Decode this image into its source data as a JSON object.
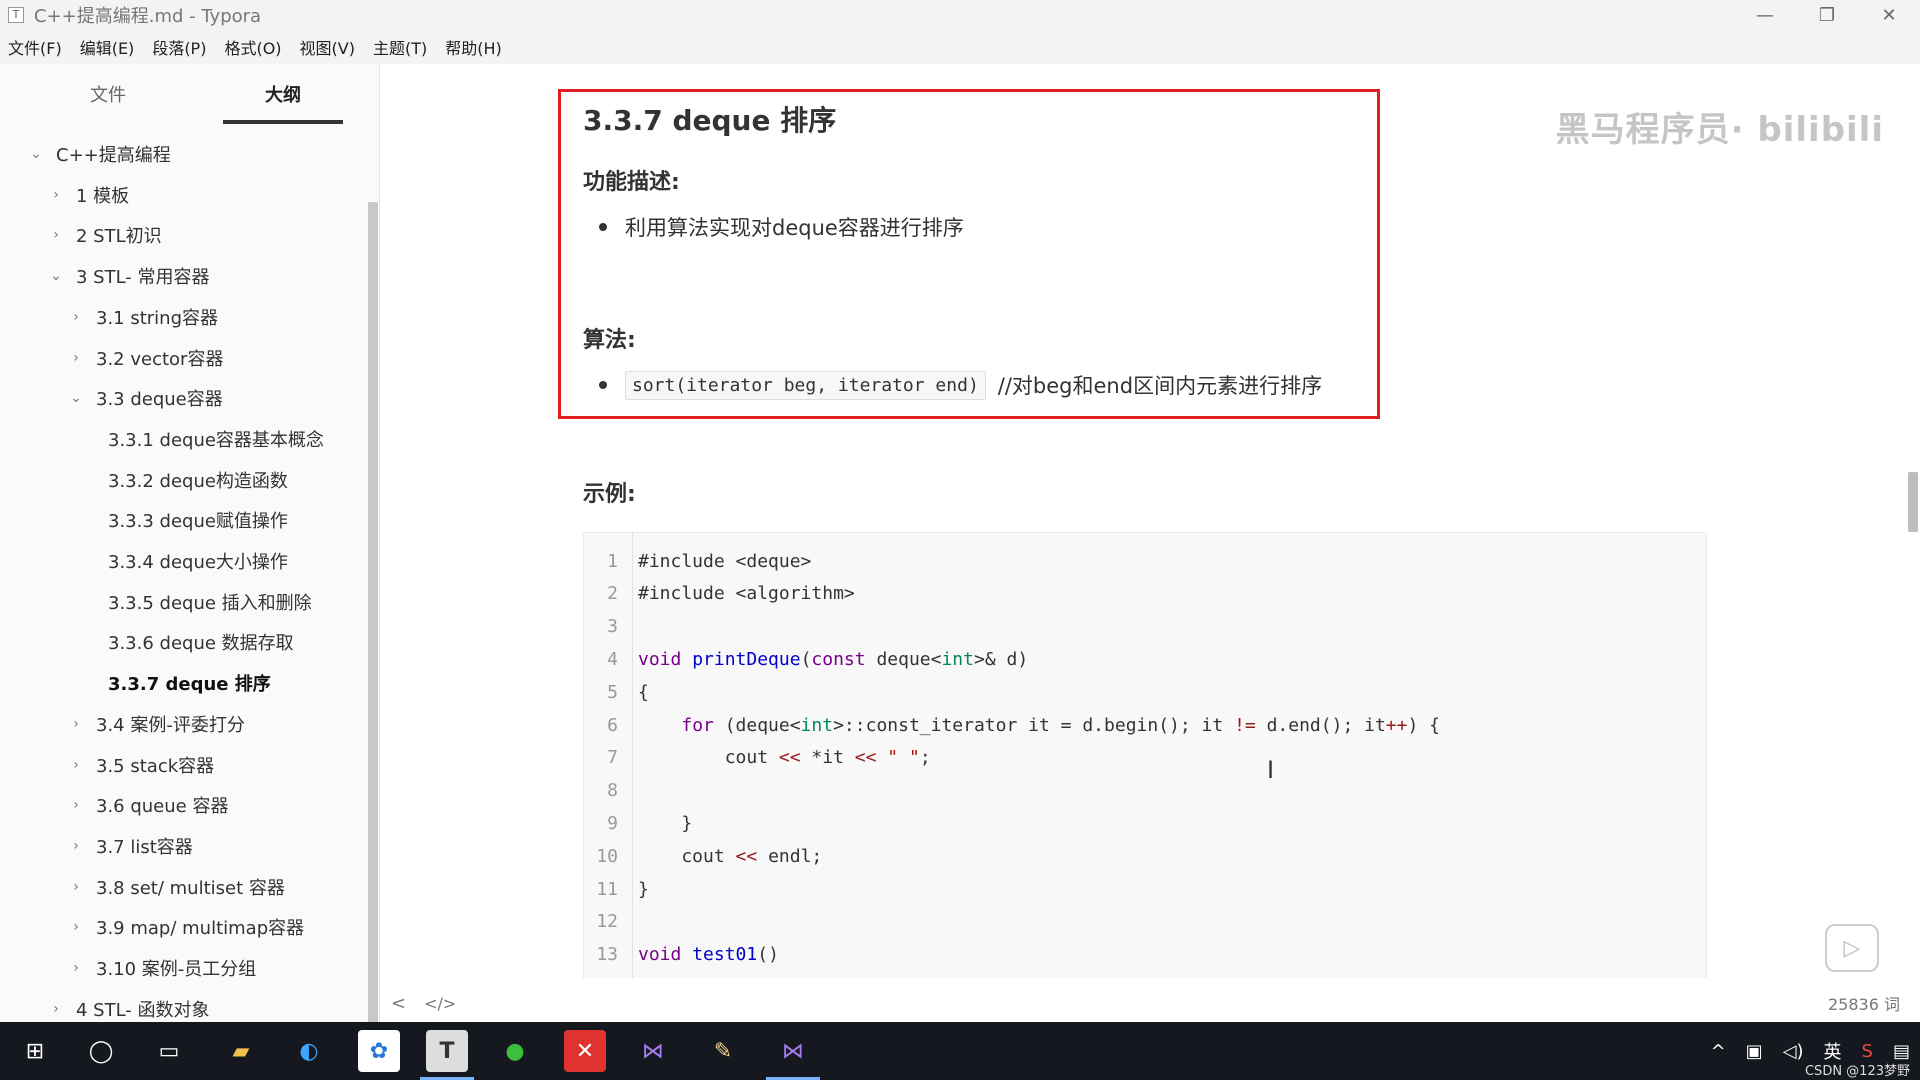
{
  "window": {
    "app_icon": "T",
    "title": "C++提高编程.md - Typora",
    "minimize": "—",
    "restore": "❐",
    "close": "✕"
  },
  "menu": [
    "文件(F)",
    "编辑(E)",
    "段落(P)",
    "格式(O)",
    "视图(V)",
    "主题(T)",
    "帮助(H)"
  ],
  "sidebar": {
    "tabs": [
      "文件",
      "大纲"
    ],
    "outline": [
      {
        "label": "C++提高编程",
        "level": 0,
        "expanded": true
      },
      {
        "label": "1 模板",
        "level": 1,
        "expanded": false
      },
      {
        "label": "2 STL初识",
        "level": 1,
        "expanded": false
      },
      {
        "label": "3 STL- 常用容器",
        "level": 1,
        "expanded": true
      },
      {
        "label": "3.1 string容器",
        "level": 2,
        "expanded": false
      },
      {
        "label": "3.2 vector容器",
        "level": 2,
        "expanded": false
      },
      {
        "label": "3.3 deque容器",
        "level": 2,
        "expanded": true
      },
      {
        "label": "3.3.1 deque容器基本概念",
        "level": 3
      },
      {
        "label": "3.3.2 deque构造函数",
        "level": 3
      },
      {
        "label": "3.3.3 deque赋值操作",
        "level": 3
      },
      {
        "label": "3.3.4 deque大小操作",
        "level": 3
      },
      {
        "label": "3.3.5 deque 插入和删除",
        "level": 3
      },
      {
        "label": "3.3.6 deque 数据存取",
        "level": 3
      },
      {
        "label": "3.3.7 deque 排序",
        "level": 3,
        "active": true
      },
      {
        "label": "3.4 案例-评委打分",
        "level": 2,
        "expanded": false
      },
      {
        "label": "3.5 stack容器",
        "level": 2,
        "expanded": false
      },
      {
        "label": "3.6 queue 容器",
        "level": 2,
        "expanded": false
      },
      {
        "label": "3.7 list容器",
        "level": 2,
        "expanded": false
      },
      {
        "label": "3.8 set/ multiset 容器",
        "level": 2,
        "expanded": false
      },
      {
        "label": "3.9 map/ multimap容器",
        "level": 2,
        "expanded": false
      },
      {
        "label": "3.10 案例-员工分组",
        "level": 2,
        "expanded": false
      },
      {
        "label": "4 STL- 函数对象",
        "level": 1,
        "expanded": false
      }
    ]
  },
  "doc": {
    "heading": "3.3.7  deque 排序",
    "section_func": "功能描述:",
    "func_bullet": "利用算法实现对deque容器进行排序",
    "section_algo": "算法:",
    "algo_code": "sort(iterator beg, iterator end)",
    "algo_comment": "//对beg和end区间内元素进行排序",
    "section_example": "示例:"
  },
  "code": [
    {
      "n": "1",
      "text": "#include <deque>"
    },
    {
      "n": "2",
      "text": "#include <algorithm>"
    },
    {
      "n": "3",
      "text": ""
    },
    {
      "n": "4",
      "text": "void printDeque(const deque<int>& d)"
    },
    {
      "n": "5",
      "text": "{"
    },
    {
      "n": "6",
      "text": "    for (deque<int>::const_iterator it = d.begin(); it != d.end(); it++) {"
    },
    {
      "n": "7",
      "text": "        cout << *it << \" \";"
    },
    {
      "n": "8",
      "text": ""
    },
    {
      "n": "9",
      "text": "    }"
    },
    {
      "n": "10",
      "text": "    cout << endl;"
    },
    {
      "n": "11",
      "text": "}"
    },
    {
      "n": "12",
      "text": ""
    },
    {
      "n": "13",
      "text": "void test01()"
    }
  ],
  "watermark": "黑马程序员· bilibili",
  "status": {
    "back": "<",
    "source_toggle": "</>",
    "wordcount": "25836 词"
  },
  "taskbar": {
    "tray_ime": "英",
    "tray_credit": "CSDN @123梦野"
  }
}
